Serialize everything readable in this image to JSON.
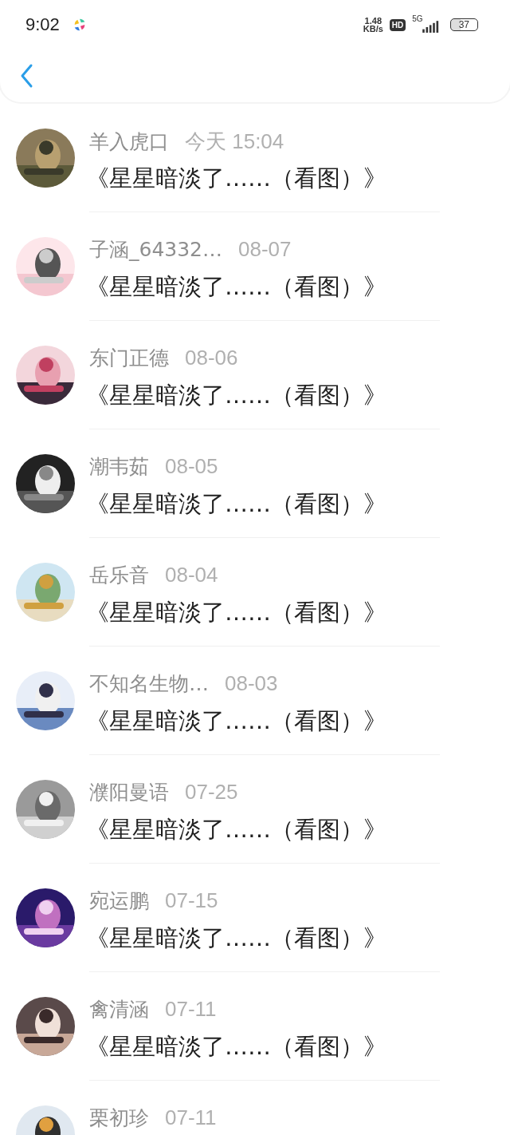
{
  "status_bar": {
    "time": "9:02",
    "speed_value": "1.48",
    "speed_unit": "KB/s",
    "hd": "HD",
    "network": "5G",
    "battery": "37"
  },
  "messages": [
    {
      "name": "羊入虎口",
      "date": "今天 15:04",
      "title": "《星星暗淡了……（看图）》"
    },
    {
      "name": "子涵_64332…",
      "date": "08-07",
      "title": "《星星暗淡了……（看图）》"
    },
    {
      "name": "东门正德",
      "date": "08-06",
      "title": "《星星暗淡了……（看图）》"
    },
    {
      "name": "潮韦茹",
      "date": "08-05",
      "title": "《星星暗淡了……（看图）》"
    },
    {
      "name": "岳乐音",
      "date": "08-04",
      "title": "《星星暗淡了……（看图）》"
    },
    {
      "name": "不知名生物…",
      "date": "08-03",
      "title": "《星星暗淡了……（看图）》"
    },
    {
      "name": "濮阳曼语",
      "date": "07-25",
      "title": "《星星暗淡了……（看图）》"
    },
    {
      "name": "宛运鹏",
      "date": "07-15",
      "title": "《星星暗淡了……（看图）》"
    },
    {
      "name": "禽清涵",
      "date": "07-11",
      "title": "《星星暗淡了……（看图）》"
    },
    {
      "name": "栗初珍",
      "date": "07-11"
    }
  ]
}
